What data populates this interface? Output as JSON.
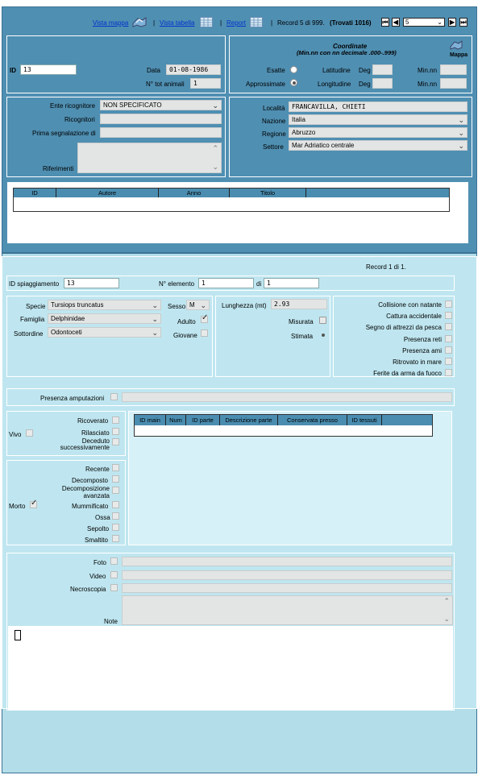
{
  "toolbar": {
    "vista_mappa": "Vista mappa",
    "vista_tabella": "Vista tabella",
    "report": "Report",
    "record_text": "Record 5 di 999.",
    "trovati": "(Trovati 1016)",
    "record_select": "5"
  },
  "coordinate": {
    "title": "Coordinate",
    "subtitle": "(Min.nn con nn decimale .000-.999)",
    "mappa": "Mappa",
    "esatte": "Esatte",
    "approssimate": "Approssimate",
    "latitudine": "Latitudine",
    "longitudine": "Longitudine",
    "deg": "Deg",
    "minnn": "Min.nn"
  },
  "record": {
    "id_label": "ID",
    "id_value": "13",
    "data_label": "Data",
    "data_value": "01-08-1986",
    "ntot_label": "N° tot animali",
    "ntot_value": "1"
  },
  "ente": {
    "ente_label": "Ente ricognitore",
    "ente_value": "NON SPECIFICATO",
    "ricognitori_label": "Ricognitori",
    "prima_label": "Prima segnalazione di",
    "riferimenti_label": "Riferimenti"
  },
  "localita": {
    "localita_label": "Località",
    "localita_value": "FRANCAVILLA, CHIETI",
    "nazione_label": "Nazione",
    "nazione_value": "Italia",
    "regione_label": "Regione",
    "regione_value": "Abruzzo",
    "settore_label": "Settore",
    "settore_value": "Mar Adriatico centrale"
  },
  "biblio": {
    "columns": [
      "ID",
      "Autore",
      "Anno",
      "Titolo"
    ]
  },
  "spiaggiamento": {
    "record_text": "Record 1 di 1.",
    "id_label": "ID spiaggiamento",
    "id_value": "13",
    "nelem_label": "N° elemento",
    "nelem_value": "1",
    "di_label": "di",
    "di_value": "1"
  },
  "specie": {
    "specie_label": "Specie",
    "specie_value": "Tursiops truncatus",
    "famiglia_label": "Famiglia",
    "famiglia_value": "Delphinidae",
    "sottordine_label": "Sottordine",
    "sottordine_value": "Odontoceti",
    "sesso_label": "Sesso",
    "sesso_value": "M",
    "adulto_label": "Adulto",
    "giovane_label": "Giovane"
  },
  "lunghezza": {
    "label": "Lunghezza (mt)",
    "value": "2.93",
    "misurata": "Misurata",
    "stimata": "Stimata"
  },
  "cause": {
    "items": [
      "Collisione con natante",
      "Cattura accidentale",
      "Segno di attrezzi da pesca",
      "Presenza reti",
      "Presenza ami",
      "Ritrovato in mare",
      "Ferite da arma da fuoco"
    ]
  },
  "amputazioni": {
    "label": "Presenza amputazioni"
  },
  "vivo": {
    "label": "Vivo",
    "items": [
      "Ricoverato",
      "Rilasciato",
      "Deceduto successivamente"
    ]
  },
  "morto": {
    "label": "Morto",
    "items": [
      "Recente",
      "Decomposto",
      "Decomposizione avanzata",
      "Mummificato",
      "Ossa",
      "Sepolto",
      "Smaltito"
    ]
  },
  "campioni": {
    "columns": [
      "ID main",
      "Num",
      "ID parte",
      "Descrizione parte",
      "Conservata presso",
      "ID tessuti"
    ]
  },
  "media": {
    "foto": "Foto",
    "video": "Video",
    "necroscopia": "Necroscopia",
    "note": "Note"
  },
  "colors": {
    "dark_panel": "#4f8fb2",
    "light_panel": "#bfe6f0",
    "link": "#0033cc"
  }
}
